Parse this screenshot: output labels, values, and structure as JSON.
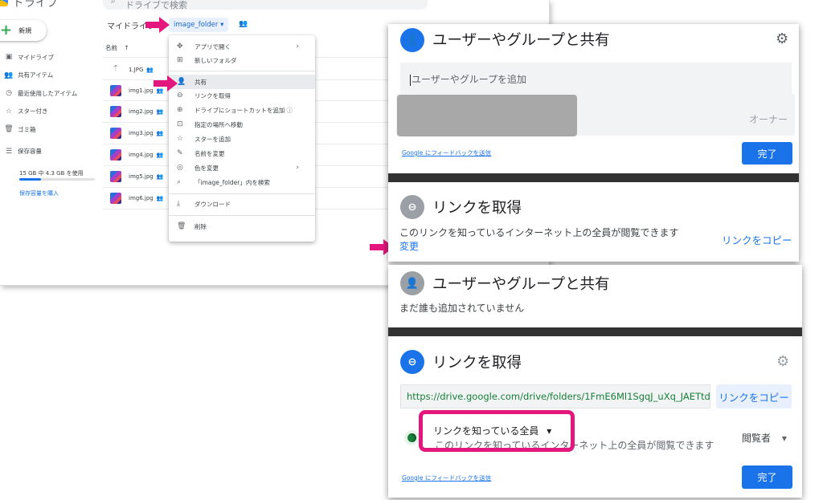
{
  "drive": {
    "app_name": "ドライブ",
    "search_placeholder": "ドライブで検索",
    "new_label": "新規",
    "nav": [
      {
        "icon": "drive-icon",
        "glyph": "▣",
        "label": "マイドライブ"
      },
      {
        "icon": "shared-people-icon",
        "glyph": "👥",
        "label": "共有アイテム"
      },
      {
        "icon": "clock-icon",
        "glyph": "◷",
        "label": "最近使用したアイテム"
      },
      {
        "icon": "star-icon",
        "glyph": "☆",
        "label": "スター付き"
      },
      {
        "icon": "trash-icon",
        "glyph": "🗑",
        "label": "ゴミ箱"
      },
      {
        "icon": "storage-icon",
        "glyph": "☰",
        "label": "保存容量"
      }
    ],
    "storage_text": "15 GB 中 4.3 GB を使用",
    "storage_fraction": 0.29,
    "storage_buy": "保存容量を購入",
    "breadcrumb_root": "マイドライブ",
    "breadcrumb_current": "image_folder",
    "column_name": "名前",
    "sort_glyph": "↑",
    "files": [
      "1.JPG",
      "img1.jpg",
      "img2.jpg",
      "img3.jpg",
      "img4.jpg",
      "img5.jpg",
      "img6.jpg"
    ]
  },
  "context_menu": [
    {
      "icon": "move-icon",
      "glyph": "✥",
      "label": "アプリで開く",
      "submenu": true
    },
    {
      "icon": "new-folder-icon",
      "glyph": "⊞",
      "label": "新しいフォルダ"
    },
    {
      "icon": "add-person-icon",
      "glyph": "👤",
      "label": "共有"
    },
    {
      "icon": "link-icon",
      "glyph": "⊖",
      "label": "リンクを取得"
    },
    {
      "icon": "drive-shortcut-icon",
      "glyph": "⊕",
      "label": "ドライブにショートカットを追加"
    },
    {
      "icon": "move-folder-icon",
      "glyph": "⊡",
      "label": "指定の場所へ移動"
    },
    {
      "icon": "star-icon",
      "glyph": "☆",
      "label": "スターを追加"
    },
    {
      "icon": "pencil-icon",
      "glyph": "✎",
      "label": "名前を変更"
    },
    {
      "icon": "palette-icon",
      "glyph": "◎",
      "label": "色を変更",
      "submenu": true
    },
    {
      "icon": "search-icon",
      "glyph": "⌕",
      "label": "「image_folder」内を検索"
    },
    {
      "icon": "download-icon",
      "glyph": "⤓",
      "label": "ダウンロード"
    },
    {
      "icon": "trash-icon",
      "glyph": "🗑",
      "label": "削除"
    }
  ],
  "share_dialog": {
    "title": "ユーザーやグループと共有",
    "add_placeholder": "ユーザーやグループを追加",
    "owner_label": "オーナー",
    "feedback_link": "Google にフィードバックを送信",
    "done_label": "完了",
    "link_title": "リンクを取得",
    "link_desc": "このリンクを知っているインターネット上の全員が閲覧できます",
    "change_label": "変更",
    "copy_label": "リンクをコピー"
  },
  "link_dialog": {
    "share_title": "ユーザーやグループと共有",
    "no_one_added": "まだ誰も追加されていません",
    "link_title": "リンクを取得",
    "url": "https://drive.google.com/drive/folders/1FmE6Ml1SgqJ_uXq_JAETtdk...",
    "copy_label": "リンクをコピー",
    "access_label": "リンクを知っている全員",
    "access_desc": "このリンクを知っているインターネット上の全員が閲覧できます",
    "role_label": "閲覧者",
    "feedback_link": "Google にフィードバックを送信",
    "done_label": "完了"
  },
  "colors": {
    "accent": "#1a73e8",
    "highlight_pink": "#e3177d",
    "url_green": "#188038"
  }
}
